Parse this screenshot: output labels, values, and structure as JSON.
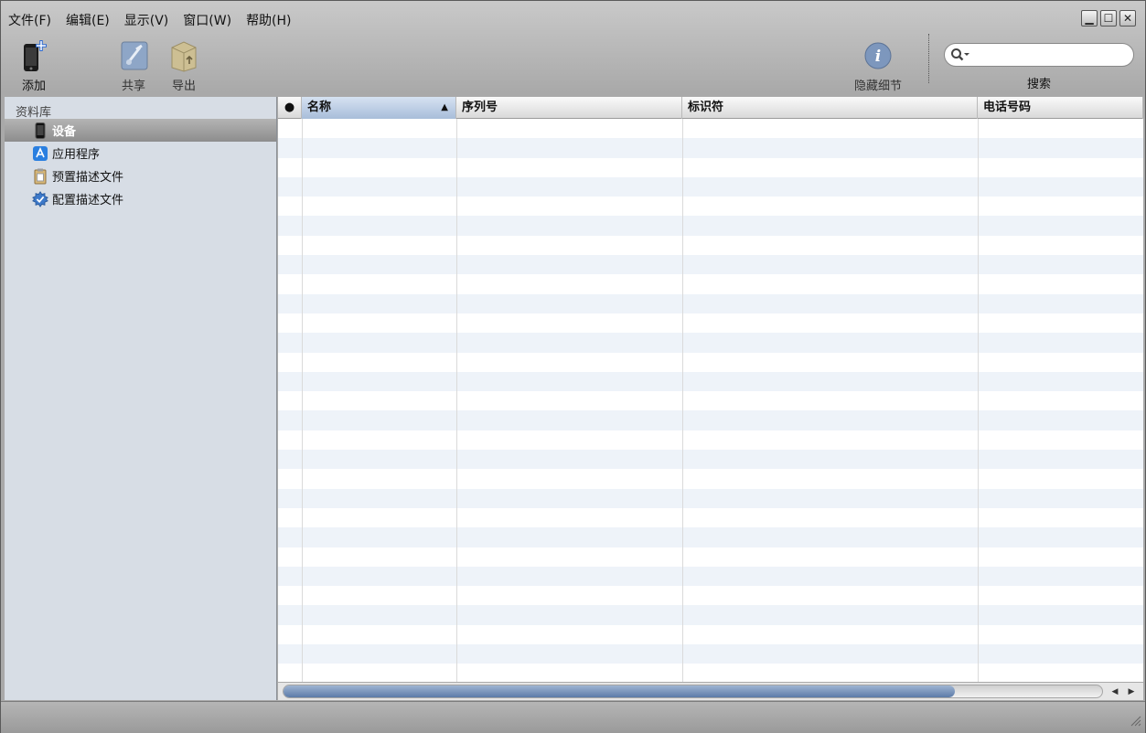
{
  "menu": [
    "文件(F)",
    "编辑(E)",
    "显示(V)",
    "窗口(W)",
    "帮助(H)"
  ],
  "window_controls": {
    "minimize": "▁",
    "maximize": "☐",
    "close": "✕"
  },
  "toolbar": {
    "add_label": "添加",
    "share_label": "共享",
    "export_label": "导出",
    "hide_details_label": "隐藏细节",
    "search_label": "搜索",
    "search_value": ""
  },
  "sidebar": {
    "header": "资料库",
    "items": [
      {
        "label": "设备",
        "icon": "iphone-icon",
        "selected": true
      },
      {
        "label": "应用程序",
        "icon": "app-store-icon",
        "selected": false
      },
      {
        "label": "预置描述文件",
        "icon": "provisioning-profile-icon",
        "selected": false
      },
      {
        "label": "配置描述文件",
        "icon": "configuration-profile-icon",
        "selected": false
      }
    ]
  },
  "table": {
    "columns": [
      "●",
      "名称",
      "序列号",
      "标识符",
      "电话号码"
    ],
    "sorted_column": "名称",
    "sort_direction": "ascending",
    "rows": []
  },
  "colors": {
    "selection": "#9c9c9c",
    "sidebar_bg": "#d7dde5",
    "stripe": "#eef3f9",
    "scroll_thumb": "#6f8db7"
  }
}
